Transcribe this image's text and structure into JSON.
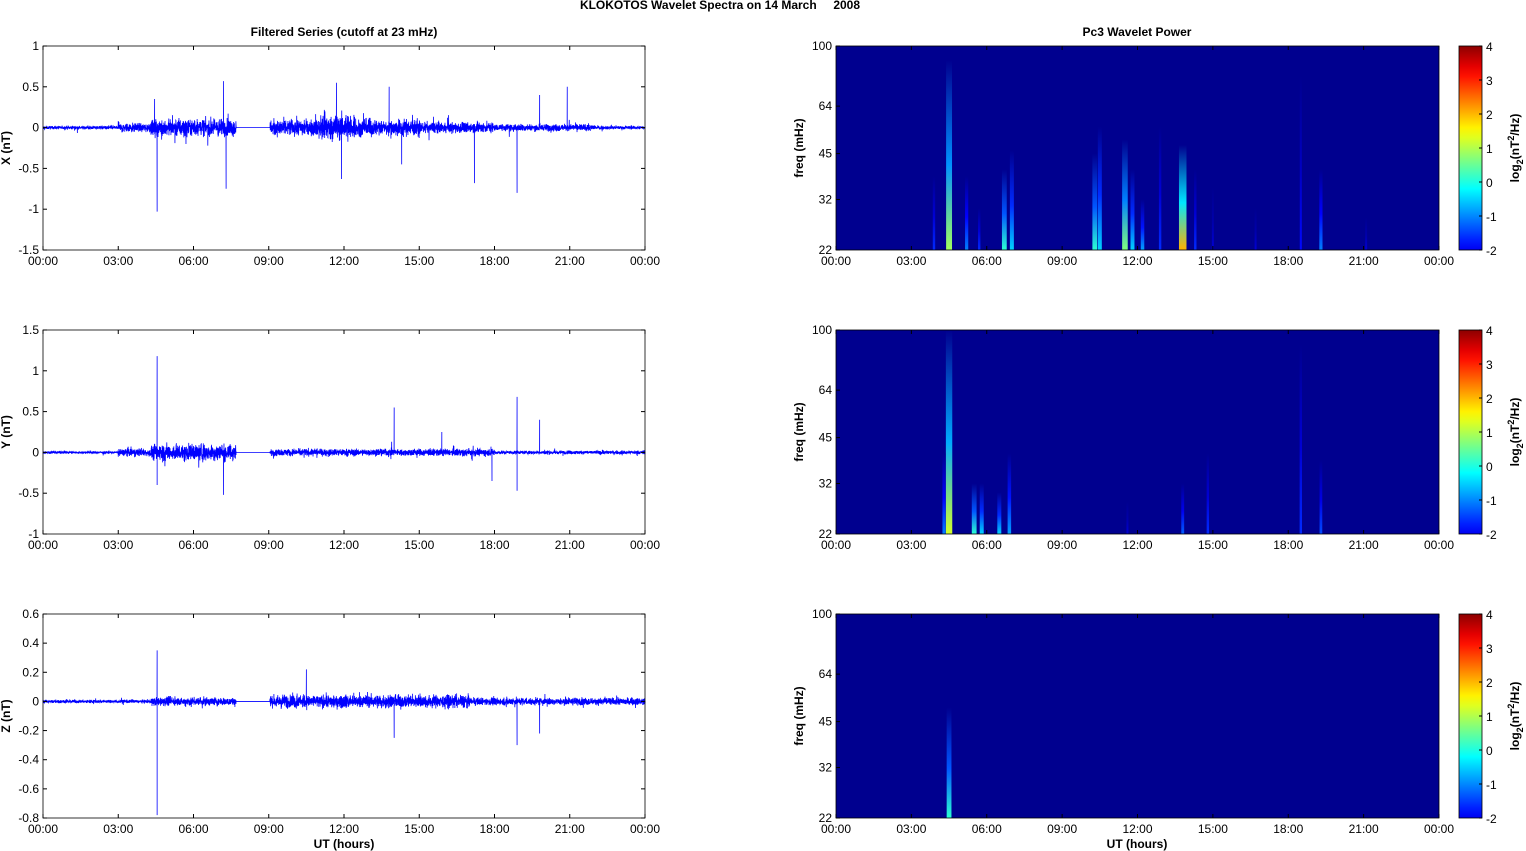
{
  "figure_title": "KLOKOTOS Wavelet Spectra on 14 March     2008",
  "left_title": "Filtered Series (cutoff at 23 mHz)",
  "right_title": "Pc3 Wavelet Power",
  "xlabel": "UT (hours)",
  "time_ticks": [
    "00:00",
    "03:00",
    "06:00",
    "09:00",
    "12:00",
    "15:00",
    "18:00",
    "21:00",
    "00:00"
  ],
  "freq_label": "freq (mHz)",
  "freq_ticks": [
    "22",
    "32",
    "45",
    "64",
    "100"
  ],
  "colorbar_label": "log2(nT2/Hz)",
  "colorbar_ticks": [
    "-2",
    "-1",
    "0",
    "1",
    "2",
    "3",
    "4"
  ],
  "chart_data": [
    {
      "type": "line",
      "name": "X",
      "ylabel": "X (nT)",
      "ylim": [
        -1.5,
        1
      ],
      "yticks": [
        "-1.5",
        "-1",
        "-0.5",
        "0",
        "0.5",
        "1"
      ],
      "xlim_hours": [
        0,
        24
      ],
      "gap_hours": [
        7.7,
        9.05
      ],
      "activity": [
        [
          0,
          3,
          0.03
        ],
        [
          3,
          4.3,
          0.08
        ],
        [
          4.3,
          7.7,
          0.14
        ],
        [
          9.05,
          11,
          0.14
        ],
        [
          11,
          12.5,
          0.22
        ],
        [
          12.5,
          15,
          0.14
        ],
        [
          15,
          18,
          0.09
        ],
        [
          18,
          22,
          0.06
        ],
        [
          22,
          24,
          0.03
        ]
      ],
      "spikes": [
        [
          4.55,
          -1.03
        ],
        [
          4.45,
          0.35
        ],
        [
          7.2,
          0.57
        ],
        [
          7.3,
          -0.75
        ],
        [
          11.9,
          -0.63
        ],
        [
          11.7,
          0.55
        ],
        [
          13.8,
          0.5
        ],
        [
          14.3,
          -0.45
        ],
        [
          17.2,
          -0.68
        ],
        [
          18.9,
          -0.8
        ],
        [
          20.9,
          0.5
        ],
        [
          19.8,
          0.4
        ]
      ]
    },
    {
      "type": "line",
      "name": "Y",
      "ylabel": "Y (nT)",
      "ylim": [
        -1,
        1.5
      ],
      "yticks": [
        "-1",
        "-0.5",
        "0",
        "0.5",
        "1",
        "1.5"
      ],
      "xlim_hours": [
        0,
        24
      ],
      "gap_hours": [
        7.7,
        9.05
      ],
      "activity": [
        [
          0,
          3,
          0.02
        ],
        [
          3,
          4.3,
          0.07
        ],
        [
          4.3,
          7.7,
          0.14
        ],
        [
          9.05,
          18,
          0.06
        ],
        [
          18,
          24,
          0.03
        ]
      ],
      "spikes": [
        [
          4.55,
          1.18
        ],
        [
          4.55,
          -0.4
        ],
        [
          7.2,
          -0.52
        ],
        [
          14,
          0.55
        ],
        [
          18.9,
          0.68
        ],
        [
          18.9,
          -0.47
        ],
        [
          19.8,
          0.4
        ],
        [
          15.9,
          0.25
        ],
        [
          17.9,
          -0.35
        ]
      ]
    },
    {
      "type": "line",
      "name": "Z",
      "ylabel": "Z (nT)",
      "ylim": [
        -0.8,
        0.6
      ],
      "yticks": [
        "-0.8",
        "-0.6",
        "-0.4",
        "-0.2",
        "0",
        "0.2",
        "0.4",
        "0.6"
      ],
      "xlim_hours": [
        0,
        24
      ],
      "gap_hours": [
        7.7,
        9.05
      ],
      "activity": [
        [
          0,
          4.3,
          0.015
        ],
        [
          4.3,
          7.7,
          0.04
        ],
        [
          9.05,
          17,
          0.06
        ],
        [
          17,
          24,
          0.035
        ]
      ],
      "spikes": [
        [
          4.55,
          0.35
        ],
        [
          4.55,
          -0.78
        ],
        [
          10.5,
          0.22
        ],
        [
          14,
          -0.25
        ],
        [
          18.9,
          -0.3
        ],
        [
          19.8,
          -0.22
        ]
      ]
    },
    {
      "type": "heatmap",
      "name": "X wavelet power",
      "flim_mHz": [
        22,
        100
      ],
      "clim_log2": [
        -2,
        4
      ],
      "background_log2": -2,
      "events": [
        [
          4.5,
          90,
          1.2
        ],
        [
          3.9,
          38,
          -1
        ],
        [
          5.2,
          38,
          -0.5
        ],
        [
          5.7,
          30,
          -1
        ],
        [
          6.7,
          40,
          0.5
        ],
        [
          7.0,
          46,
          0
        ],
        [
          10.3,
          45,
          0.5
        ],
        [
          10.5,
          55,
          0
        ],
        [
          11.5,
          50,
          1
        ],
        [
          11.8,
          40,
          0
        ],
        [
          12.2,
          32,
          -0.3
        ],
        [
          12.9,
          55,
          -1
        ],
        [
          13.8,
          48,
          2.2
        ],
        [
          14.3,
          40,
          -1
        ],
        [
          15,
          35,
          -1.5
        ],
        [
          16.7,
          30,
          -1.5
        ],
        [
          18.5,
          80,
          -1.2
        ],
        [
          19.3,
          40,
          -0.5
        ],
        [
          21.1,
          28,
          -1.5
        ]
      ]
    },
    {
      "type": "heatmap",
      "name": "Y wavelet power",
      "flim_mHz": [
        22,
        100
      ],
      "clim_log2": [
        -2,
        4
      ],
      "background_log2": -2,
      "events": [
        [
          4.5,
          100,
          1.5
        ],
        [
          4.3,
          40,
          -0.5
        ],
        [
          5.5,
          32,
          0.5
        ],
        [
          5.8,
          32,
          0
        ],
        [
          6.5,
          30,
          0
        ],
        [
          6.9,
          40,
          -0.3
        ],
        [
          13.8,
          32,
          -0.7
        ],
        [
          14.8,
          40,
          -1
        ],
        [
          18.5,
          90,
          -1
        ],
        [
          19.3,
          38,
          -0.8
        ],
        [
          11.6,
          28,
          -1.5
        ]
      ]
    },
    {
      "type": "heatmap",
      "name": "Z wavelet power",
      "flim_mHz": [
        22,
        100
      ],
      "clim_log2": [
        -2,
        4
      ],
      "background_log2": -2,
      "events": [
        [
          4.5,
          50,
          0.5
        ]
      ]
    }
  ]
}
